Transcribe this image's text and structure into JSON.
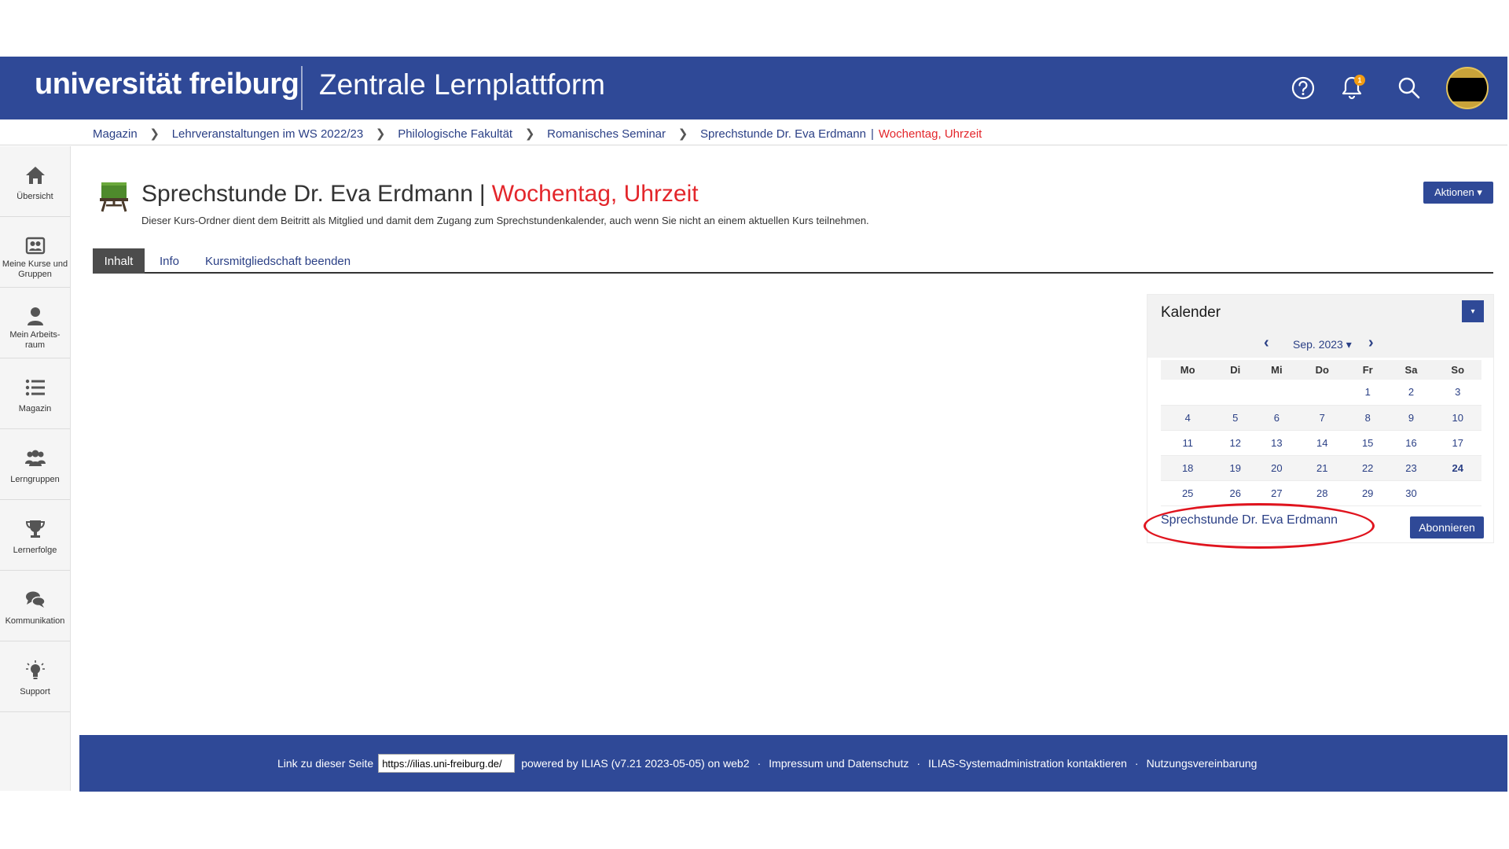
{
  "header": {
    "logo": "universität freiburg",
    "app_title": "Zentrale Lernplattform",
    "notification_count": "1"
  },
  "breadcrumb": {
    "items": [
      "Magazin",
      "Lehrveranstaltungen im WS 2022/23",
      "Philologische Fakultät",
      "Romanisches Seminar",
      "Sprechstunde Dr. Eva Erdmann"
    ],
    "separator": "|",
    "current": "Wochentag, Uhrzeit"
  },
  "sidebar": {
    "items": [
      {
        "label": "Übersicht",
        "icon": "home-icon"
      },
      {
        "label": "Meine Kurse und Gruppen",
        "icon": "courses-icon"
      },
      {
        "label": "Mein Arbeits- raum",
        "icon": "user-icon"
      },
      {
        "label": "Magazin",
        "icon": "list-icon"
      },
      {
        "label": "Lerngruppen",
        "icon": "groups-icon"
      },
      {
        "label": "Lernerfolge",
        "icon": "trophy-icon"
      },
      {
        "label": "Kommunikation",
        "icon": "chat-icon"
      },
      {
        "label": "Support",
        "icon": "lightbulb-icon"
      }
    ]
  },
  "page": {
    "title": "Sprechstunde Dr. Eva Erdmann",
    "title_separator": "|",
    "title_red": "Wochentag, Uhrzeit",
    "description": "Dieser Kurs-Ordner dient dem Beitritt als Mitglied und damit dem Zugang zum Sprechstundenkalender, auch wenn Sie nicht an einem aktuellen Kurs teilnehmen.",
    "actions_label": "Aktionen ▾"
  },
  "tabs": [
    "Inhalt",
    "Info",
    "Kursmitgliedschaft beenden"
  ],
  "calendar": {
    "title": "Kalender",
    "dropdown_label": "▾",
    "prev": "‹",
    "next": "›",
    "month_label": "Sep. 2023 ▾",
    "weekdays": [
      "Mo",
      "Di",
      "Mi",
      "Do",
      "Fr",
      "Sa",
      "So"
    ],
    "weeks": [
      [
        "",
        "",
        "",
        "",
        "1",
        "2",
        "3"
      ],
      [
        "4",
        "5",
        "6",
        "7",
        "8",
        "9",
        "10"
      ],
      [
        "11",
        "12",
        "13",
        "14",
        "15",
        "16",
        "17"
      ],
      [
        "18",
        "19",
        "20",
        "21",
        "22",
        "23",
        "24"
      ],
      [
        "25",
        "26",
        "27",
        "28",
        "29",
        "30",
        ""
      ]
    ],
    "today": "24",
    "calendar_link": "Sprechstunde Dr. Eva Erdmann",
    "subscribe_label": "Abonnieren"
  },
  "footer": {
    "link_label": "Link zu dieser Seite",
    "link_value": "https://ilias.uni-freiburg.de/",
    "powered_by": "powered by ILIAS (v7.21 2023-05-05) on web2",
    "links": [
      "Impressum und Datenschutz",
      "ILIAS-Systemadministration kontaktieren",
      "Nutzungsvereinbarung"
    ],
    "dot": "·"
  },
  "colors": {
    "brand_blue": "#2f4997",
    "link_blue": "#2a3f85",
    "accent_red": "#e3262b",
    "badge_orange": "#f39c12",
    "annotation_red": "#e0141e"
  }
}
